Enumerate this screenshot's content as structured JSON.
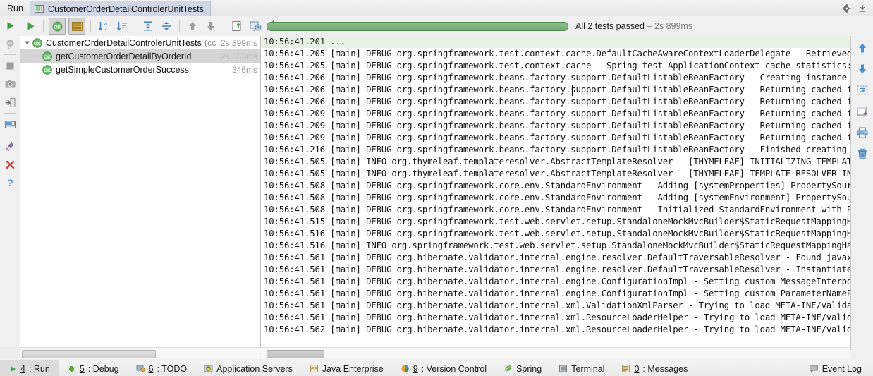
{
  "titlebar": {
    "run_label": "Run",
    "tab_label": "CustomerOrderDetailControlerUnitTests",
    "tab_icon": "run-config-icon",
    "settings_icon": "gear-icon",
    "hide_icon": "hide-icon"
  },
  "left_toolbar": [
    {
      "name": "rerun-icon",
      "label": "Rerun"
    },
    {
      "name": "rerun-failed-icon",
      "label": "Rerun failed tests"
    },
    {
      "name": "stop-icon",
      "label": "Stop"
    },
    {
      "name": "screenshot-icon",
      "label": "Dump threads"
    },
    {
      "name": "export-import-icon",
      "label": "Import Test Results"
    },
    {
      "name": "layout-icon",
      "label": "Layout"
    },
    {
      "name": "pin-icon",
      "label": "Pin Tab"
    },
    {
      "name": "close-icon",
      "label": "Close"
    },
    {
      "name": "help-icon",
      "label": "Help"
    }
  ],
  "toolbar": {
    "buttons": [
      {
        "name": "run-button",
        "icon": "play-icon",
        "pressed": false,
        "label": "Run"
      },
      {
        "name": "show-passed-toggle",
        "icon": "ok-filter-icon",
        "pressed": true,
        "label": "Show Passed"
      },
      {
        "name": "show-ignored-toggle",
        "icon": "list-icon",
        "pressed": true,
        "label": "Show Ignored"
      },
      {
        "name": "sort-alphabetically-button",
        "icon": "sort-alpha-icon",
        "pressed": false,
        "label": "Sort Alphabetically"
      },
      {
        "name": "sort-by-duration-button",
        "icon": "sort-duration-icon",
        "pressed": false,
        "label": "Sort by Duration"
      },
      {
        "name": "expand-all-button",
        "icon": "expand-all-icon",
        "pressed": false,
        "label": "Expand All"
      },
      {
        "name": "collapse-all-button",
        "icon": "collapse-all-icon",
        "pressed": false,
        "label": "Collapse All"
      },
      {
        "name": "prev-failed-button",
        "icon": "arrow-up-icon",
        "pressed": false,
        "label": "Previous Failed Test"
      },
      {
        "name": "next-failed-button",
        "icon": "arrow-down-icon",
        "pressed": false,
        "label": "Next Failed Test"
      },
      {
        "name": "export-results-button",
        "icon": "export-icon",
        "pressed": false,
        "label": "Export Test Results"
      },
      {
        "name": "open-results-button",
        "icon": "open-history-icon",
        "pressed": false,
        "label": "Test History"
      },
      {
        "name": "test-settings-button",
        "icon": "gear-icon",
        "pressed": false,
        "label": "Settings"
      }
    ]
  },
  "progress": {
    "percent": 100,
    "status_text": "All 2 tests passed",
    "separator": "–",
    "duration": "2s 899ms",
    "bar_color": "#7cb17c"
  },
  "test_tree": {
    "root": {
      "name": "CustomerOrderDetailControlerUnitTests",
      "suffix": "(cc",
      "duration": "2s 899ms",
      "status": "passed",
      "expanded": true,
      "selected": false
    },
    "children": [
      {
        "name": "getCustomerOrderDetailByOrderId",
        "duration": "2s 553ms",
        "status": "passed",
        "selected": true
      },
      {
        "name": "getSimpleCustomerOrderSuccess",
        "duration": "346ms",
        "status": "passed",
        "selected": false
      }
    ]
  },
  "console": {
    "lines": [
      {
        "text": "10:56:41.201 ...",
        "highlighted": true
      },
      {
        "text": "10:56:41.205 [main] DEBUG org.springframework.test.context.cache.DefaultCacheAwareContextLoaderDelegate - Retrieved A",
        "highlighted": false
      },
      {
        "text": "10:56:41.205 [main] DEBUG org.springframework.test.context.cache - Spring test ApplicationContext cache statistics: [",
        "highlighted": false
      },
      {
        "text": "10:56:41.206 [main] DEBUG org.springframework.beans.factory.support.DefaultListableBeanFactory - Creating instance of",
        "highlighted": false
      },
      {
        "text": "10:56:41.206 [main] DEBUG org.springframework.beans.factory.support.DefaultListableBeanFactory - Returning cached ins",
        "highlighted": false
      },
      {
        "text": "10:56:41.206 [main] DEBUG org.springframework.beans.factory.support.DefaultListableBeanFactory - Returning cached ins",
        "highlighted": false
      },
      {
        "text": "10:56:41.209 [main] DEBUG org.springframework.beans.factory.support.DefaultListableBeanFactory - Returning cached ins",
        "highlighted": false
      },
      {
        "text": "10:56:41.209 [main] DEBUG org.springframework.beans.factory.support.DefaultListableBeanFactory - Returning cached ins",
        "highlighted": false
      },
      {
        "text": "10:56:41.209 [main] DEBUG org.springframework.beans.factory.support.DefaultListableBeanFactory - Returning cached ins",
        "highlighted": false
      },
      {
        "text": "10:56:41.216 [main] DEBUG org.springframework.beans.factory.support.DefaultListableBeanFactory - Finished creating in",
        "highlighted": false
      },
      {
        "text": "10:56:41.505 [main] INFO org.thymeleaf.templateresolver.AbstractTemplateResolver - [THYMELEAF] INITIALIZING TEMPLATE",
        "highlighted": false
      },
      {
        "text": "10:56:41.505 [main] INFO org.thymeleaf.templateresolver.AbstractTemplateResolver - [THYMELEAF] TEMPLATE RESOLVER INIT",
        "highlighted": false
      },
      {
        "text": "10:56:41.508 [main] DEBUG org.springframework.core.env.StandardEnvironment - Adding [systemProperties] PropertySource",
        "highlighted": false
      },
      {
        "text": "10:56:41.508 [main] DEBUG org.springframework.core.env.StandardEnvironment - Adding [systemEnvironment] PropertySourc",
        "highlighted": false
      },
      {
        "text": "10:56:41.508 [main] DEBUG org.springframework.core.env.StandardEnvironment - Initialized StandardEnvironment with Pro",
        "highlighted": false
      },
      {
        "text": "10:56:41.515 [main] DEBUG org.springframework.test.web.servlet.setup.StandaloneMockMvcBuilder$StaticRequestMappingHan",
        "highlighted": false
      },
      {
        "text": "10:56:41.516 [main] DEBUG org.springframework.test.web.servlet.setup.StandaloneMockMvcBuilder$StaticRequestMappingHan",
        "highlighted": false
      },
      {
        "text": "10:56:41.516 [main] INFO org.springframework.test.web.servlet.setup.StandaloneMockMvcBuilder$StaticRequestMappingHand",
        "highlighted": false
      },
      {
        "text": "10:56:41.561 [main] DEBUG org.hibernate.validator.internal.engine.resolver.DefaultTraversableResolver - Found javax.p",
        "highlighted": false
      },
      {
        "text": "10:56:41.561 [main] DEBUG org.hibernate.validator.internal.engine.resolver.DefaultTraversableResolver - Instantiated",
        "highlighted": false
      },
      {
        "text": "10:56:41.561 [main] DEBUG org.hibernate.validator.internal.engine.ConfigurationImpl - Setting custom MessageInterpola",
        "highlighted": false
      },
      {
        "text": "10:56:41.561 [main] DEBUG org.hibernate.validator.internal.engine.ConfigurationImpl - Setting custom ParameterNamePro",
        "highlighted": false
      },
      {
        "text": "10:56:41.561 [main] DEBUG org.hibernate.validator.internal.xml.ValidationXmlParser - Trying to load META-INF/validati",
        "highlighted": false
      },
      {
        "text": "10:56:41.561 [main] DEBUG org.hibernate.validator.internal.xml.ResourceLoaderHelper - Trying to load META-INF/validat",
        "highlighted": false
      },
      {
        "text": "10:56:41.562 [main] DEBUG org.hibernate.validator.internal.xml.ResourceLoaderHelper - Trying to load META-INF/validat",
        "highlighted": false
      }
    ]
  },
  "console_toolbar": [
    {
      "name": "scroll-up-icon",
      "label": "Up the Stack Trace"
    },
    {
      "name": "scroll-down-icon",
      "label": "Down the Stack Trace"
    },
    {
      "name": "soft-wrap-icon",
      "label": "Use Soft Wraps"
    },
    {
      "name": "scroll-to-end-icon",
      "label": "Scroll to End"
    },
    {
      "name": "print-icon",
      "label": "Print"
    },
    {
      "name": "trash-icon",
      "label": "Clear All"
    }
  ],
  "statusbar": {
    "items": [
      {
        "name": "status-run",
        "mnemonic": "4",
        "label": ": Run",
        "icon": "play-icon",
        "active": true
      },
      {
        "name": "status-debug",
        "mnemonic": "5",
        "label": ": Debug",
        "icon": "bug-icon",
        "active": false
      },
      {
        "name": "status-todo",
        "mnemonic": "6",
        "label": ": TODO",
        "icon": "todo-icon",
        "active": false
      },
      {
        "name": "status-application-servers",
        "mnemonic": "",
        "label": "Application Servers",
        "icon": "server-icon",
        "active": false
      },
      {
        "name": "status-java-enterprise",
        "mnemonic": "",
        "label": "Java Enterprise",
        "icon": "jee-icon",
        "active": false
      },
      {
        "name": "status-version-control",
        "mnemonic": "9",
        "label": ": Version Control",
        "icon": "vcs-icon",
        "active": false
      },
      {
        "name": "status-spring",
        "mnemonic": "",
        "label": "Spring",
        "icon": "spring-leaf-icon",
        "active": false
      },
      {
        "name": "status-terminal",
        "mnemonic": "",
        "label": "Terminal",
        "icon": "terminal-icon",
        "active": false
      },
      {
        "name": "status-messages",
        "mnemonic": "0",
        "label": ": Messages",
        "icon": "messages-icon",
        "active": false
      }
    ],
    "event_log": {
      "label": "Event Log",
      "icon": "event-log-icon"
    }
  }
}
